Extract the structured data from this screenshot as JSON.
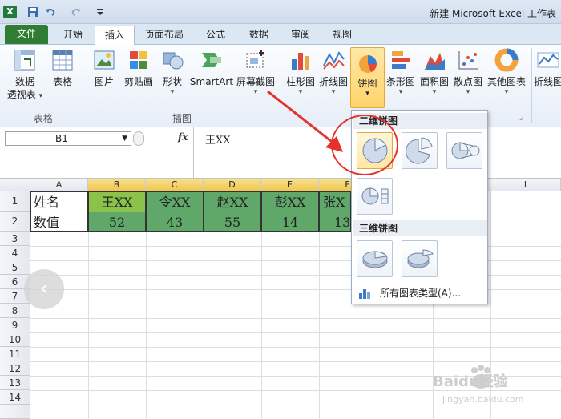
{
  "window": {
    "title": "新建 Microsoft Excel 工作表",
    "app_icon": "X"
  },
  "tabs": [
    "文件",
    "开始",
    "插入",
    "页面布局",
    "公式",
    "数据",
    "审阅",
    "视图"
  ],
  "ribbon": {
    "buttons": [
      {
        "label": "数据",
        "label2": "透视表"
      },
      {
        "label": "表格"
      },
      {
        "label": "图片"
      },
      {
        "label": "剪贴画"
      },
      {
        "label": "形状"
      },
      {
        "label": "SmartArt"
      },
      {
        "label": "屏幕截图"
      },
      {
        "label": "柱形图"
      },
      {
        "label": "折线图"
      },
      {
        "label": "饼图"
      },
      {
        "label": "条形图"
      },
      {
        "label": "面积图"
      },
      {
        "label": "散点图"
      },
      {
        "label": "其他图表"
      },
      {
        "label": "折线图"
      }
    ],
    "groups": [
      "表格",
      "插图"
    ]
  },
  "formula_bar": {
    "name_box": "B1",
    "fx": "fx",
    "content": "王XX"
  },
  "columns": [
    "A",
    "B",
    "C",
    "D",
    "E",
    "F",
    "I"
  ],
  "rows": [
    "1",
    "2",
    "3",
    "4",
    "5",
    "6",
    "7",
    "8",
    "9",
    "10",
    "11",
    "12",
    "13",
    "14"
  ],
  "table": {
    "row1": [
      "姓名",
      "王XX",
      "令XX",
      "赵XX",
      "彭XX",
      "张X"
    ],
    "row2": [
      "数值",
      "52",
      "43",
      "55",
      "14",
      "13"
    ]
  },
  "dropdown": {
    "section1": "二维饼图",
    "section2": "三维饼图",
    "all_types": "所有图表类型(A)..."
  },
  "watermark": {
    "brand": "Baidu经验",
    "url": "jingyan.baidu.com"
  },
  "colors": {
    "file_tab": "#2e7d32",
    "selected_header": "#f1c851",
    "name_fill": "#5fa86a",
    "b1_fill": "#8bc34a",
    "highlight": "#e5322d"
  }
}
